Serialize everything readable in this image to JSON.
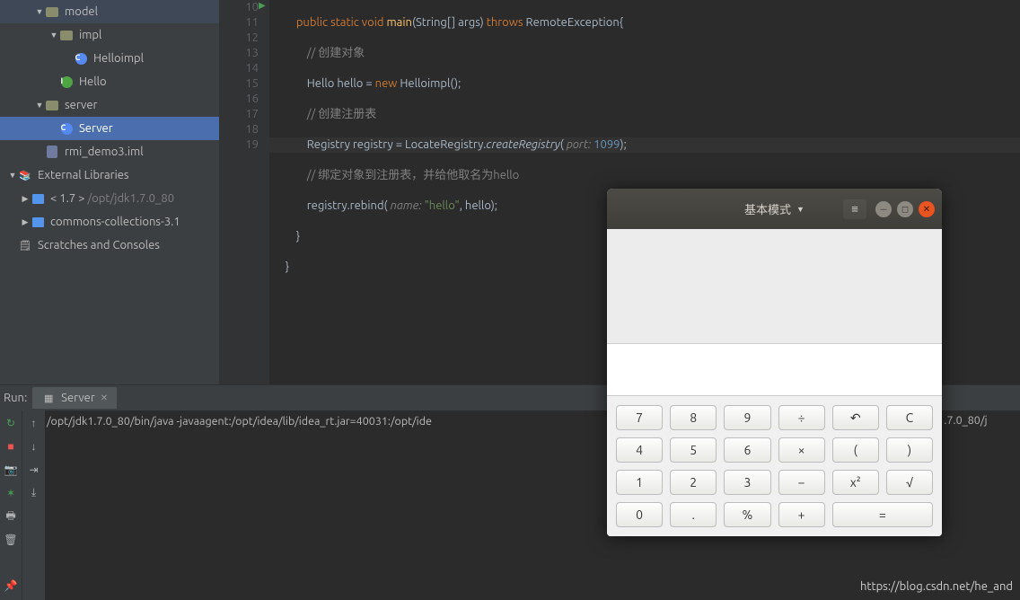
{
  "tree": {
    "model": "model",
    "impl": "impl",
    "Helloimpl": "Helloimpl",
    "Hello": "Hello",
    "server": "server",
    "Server": "Server",
    "iml": "rmi_demo3.iml",
    "ext": "External Libraries",
    "jdk_pre": "< 1.7 >",
    "jdk_path": "/opt/jdk1.7.0_80",
    "commons": "commons-collections-3.1",
    "scratches": "Scratches and Consoles"
  },
  "gutter": [
    "10",
    "11",
    "12",
    "13",
    "14",
    "15",
    "16",
    "17",
    "18",
    "19"
  ],
  "code": {
    "l10_pre": "        ",
    "l10_public": "public",
    "l10_static": "static",
    "l10_void": "void",
    "l10_main": "main",
    "l10_str": "String",
    "l10_args": "[] args",
    "l10_throws": "throws",
    "l10_exc": "RemoteException{",
    "l11": "            // 创建对象",
    "l12": "            Hello hello = ",
    "l12_new": "new",
    "l12_b": " Helloimpl();",
    "l13": "            // 创建注册表",
    "l14": "            Registry registry = LocateRegistry.",
    "l14_fn": "createRegistry",
    "l14_b": "( ",
    "l14_par": "port:",
    "l14_num": " 1099",
    "l14_c": ");",
    "l15": "            // 绑定对象到注册表，并给他取名为hello",
    "l16": "            registry.rebind( ",
    "l16_par": "name:",
    "l16_str": " \"hello\"",
    "l16_b": ", hello);",
    "l17": "        }",
    "l18": "    }",
    "l19": ""
  },
  "run": {
    "label": "Run:",
    "tab": "Server",
    "console": "/opt/jdk1.7.0_80/bin/java -javaagent:/opt/idea/lib/idea_rt.jar=40031:/opt/ide",
    "console_tail": "k1.7.0_80/j"
  },
  "attrib": "https://blog.csdn.net/he_and",
  "calc": {
    "mode": "基本模式",
    "keys": {
      "k7": "7",
      "k8": "8",
      "k9": "9",
      "kdiv": "÷",
      "kback": "↶",
      "kC": "C",
      "k4": "4",
      "k5": "5",
      "k6": "6",
      "kmul": "×",
      "klp": "(",
      "krp": ")",
      "k1": "1",
      "k2": "2",
      "k3": "3",
      "kmin": "−",
      "ksq": "x²",
      "ksqrt": "√",
      "k0": "0",
      "kdot": ".",
      "kpct": "%",
      "kpls": "+",
      "keq": "="
    }
  }
}
